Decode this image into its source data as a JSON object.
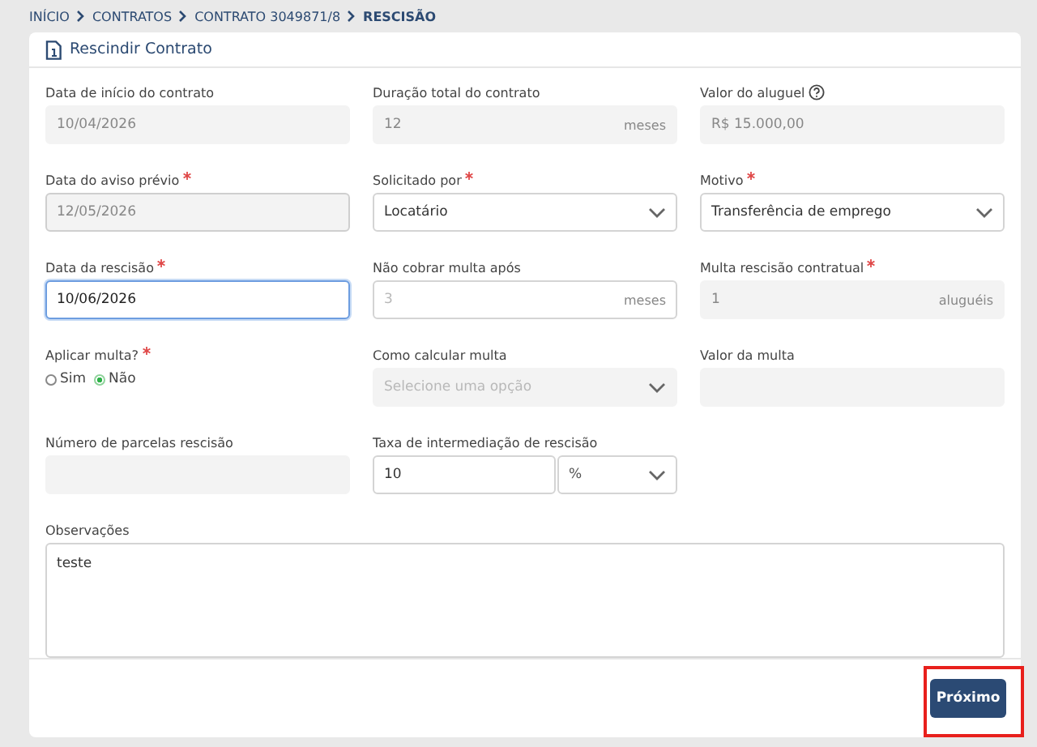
{
  "breadcrumb": [
    {
      "label": "INÍCIO",
      "current": false
    },
    {
      "label": "CONTRATOS",
      "current": false
    },
    {
      "label": "CONTRATO 3049871/8",
      "current": false
    },
    {
      "label": "RESCISÃO",
      "current": true
    }
  ],
  "card": {
    "title": "Rescindir Contrato"
  },
  "fields": [
    {
      "kind": "input",
      "label": "Data de início do contrato",
      "required": false,
      "value": "10/04/2026",
      "disabled": true,
      "focused": false
    },
    {
      "kind": "input",
      "label": "Duração total do contrato",
      "required": false,
      "value": "12",
      "suffix": "meses",
      "disabled": true,
      "focused": false
    },
    {
      "kind": "input",
      "label": "Valor do aluguel",
      "required": false,
      "help": true,
      "value": "R$ 15.000,00",
      "disabled": true,
      "focused": false
    },
    {
      "kind": "input",
      "label": "Data do aviso prévio",
      "required": true,
      "value": "12/05/2026",
      "disabled": true,
      "bordered": true,
      "focused": false
    },
    {
      "kind": "select",
      "label": "Solicitado por",
      "required": true,
      "value": "Locatário",
      "disabled": false
    },
    {
      "kind": "select",
      "label": "Motivo",
      "required": true,
      "value": "Transferência de emprego",
      "disabled": false
    },
    {
      "kind": "input",
      "label": "Data da rescisão",
      "required": true,
      "value": "10/06/2026",
      "disabled": false,
      "focused": true
    },
    {
      "kind": "input",
      "label": "Não cobrar multa após",
      "required": false,
      "placeholder": "3",
      "suffix": "meses",
      "disabled": false,
      "focused": false
    },
    {
      "kind": "input",
      "label": "Multa rescisão contratual",
      "required": true,
      "value": "1",
      "suffix": "aluguéis",
      "disabled": true,
      "focused": false
    },
    {
      "kind": "radio",
      "label": "Aplicar multa?",
      "required": true,
      "options": [
        {
          "label": "Sim",
          "selected": false
        },
        {
          "label": "Não",
          "selected": true
        }
      ]
    },
    {
      "kind": "select",
      "label": "Como calcular multa",
      "required": false,
      "placeholder": "Selecione uma opção",
      "disabled": true
    },
    {
      "kind": "input",
      "label": "Valor da multa",
      "required": false,
      "disabled": true,
      "focused": false
    },
    {
      "kind": "input",
      "label": "Número de parcelas rescisão",
      "required": false,
      "disabled": true,
      "focused": false
    },
    {
      "kind": "combo",
      "label": "Taxa de intermediação de rescisão",
      "required": false,
      "value": "10",
      "unit": "%"
    },
    {
      "kind": "textarea",
      "label": "Observações",
      "required": false,
      "value": "teste"
    }
  ],
  "next_button": {
    "label": "Próximo",
    "highlighted": true
  }
}
